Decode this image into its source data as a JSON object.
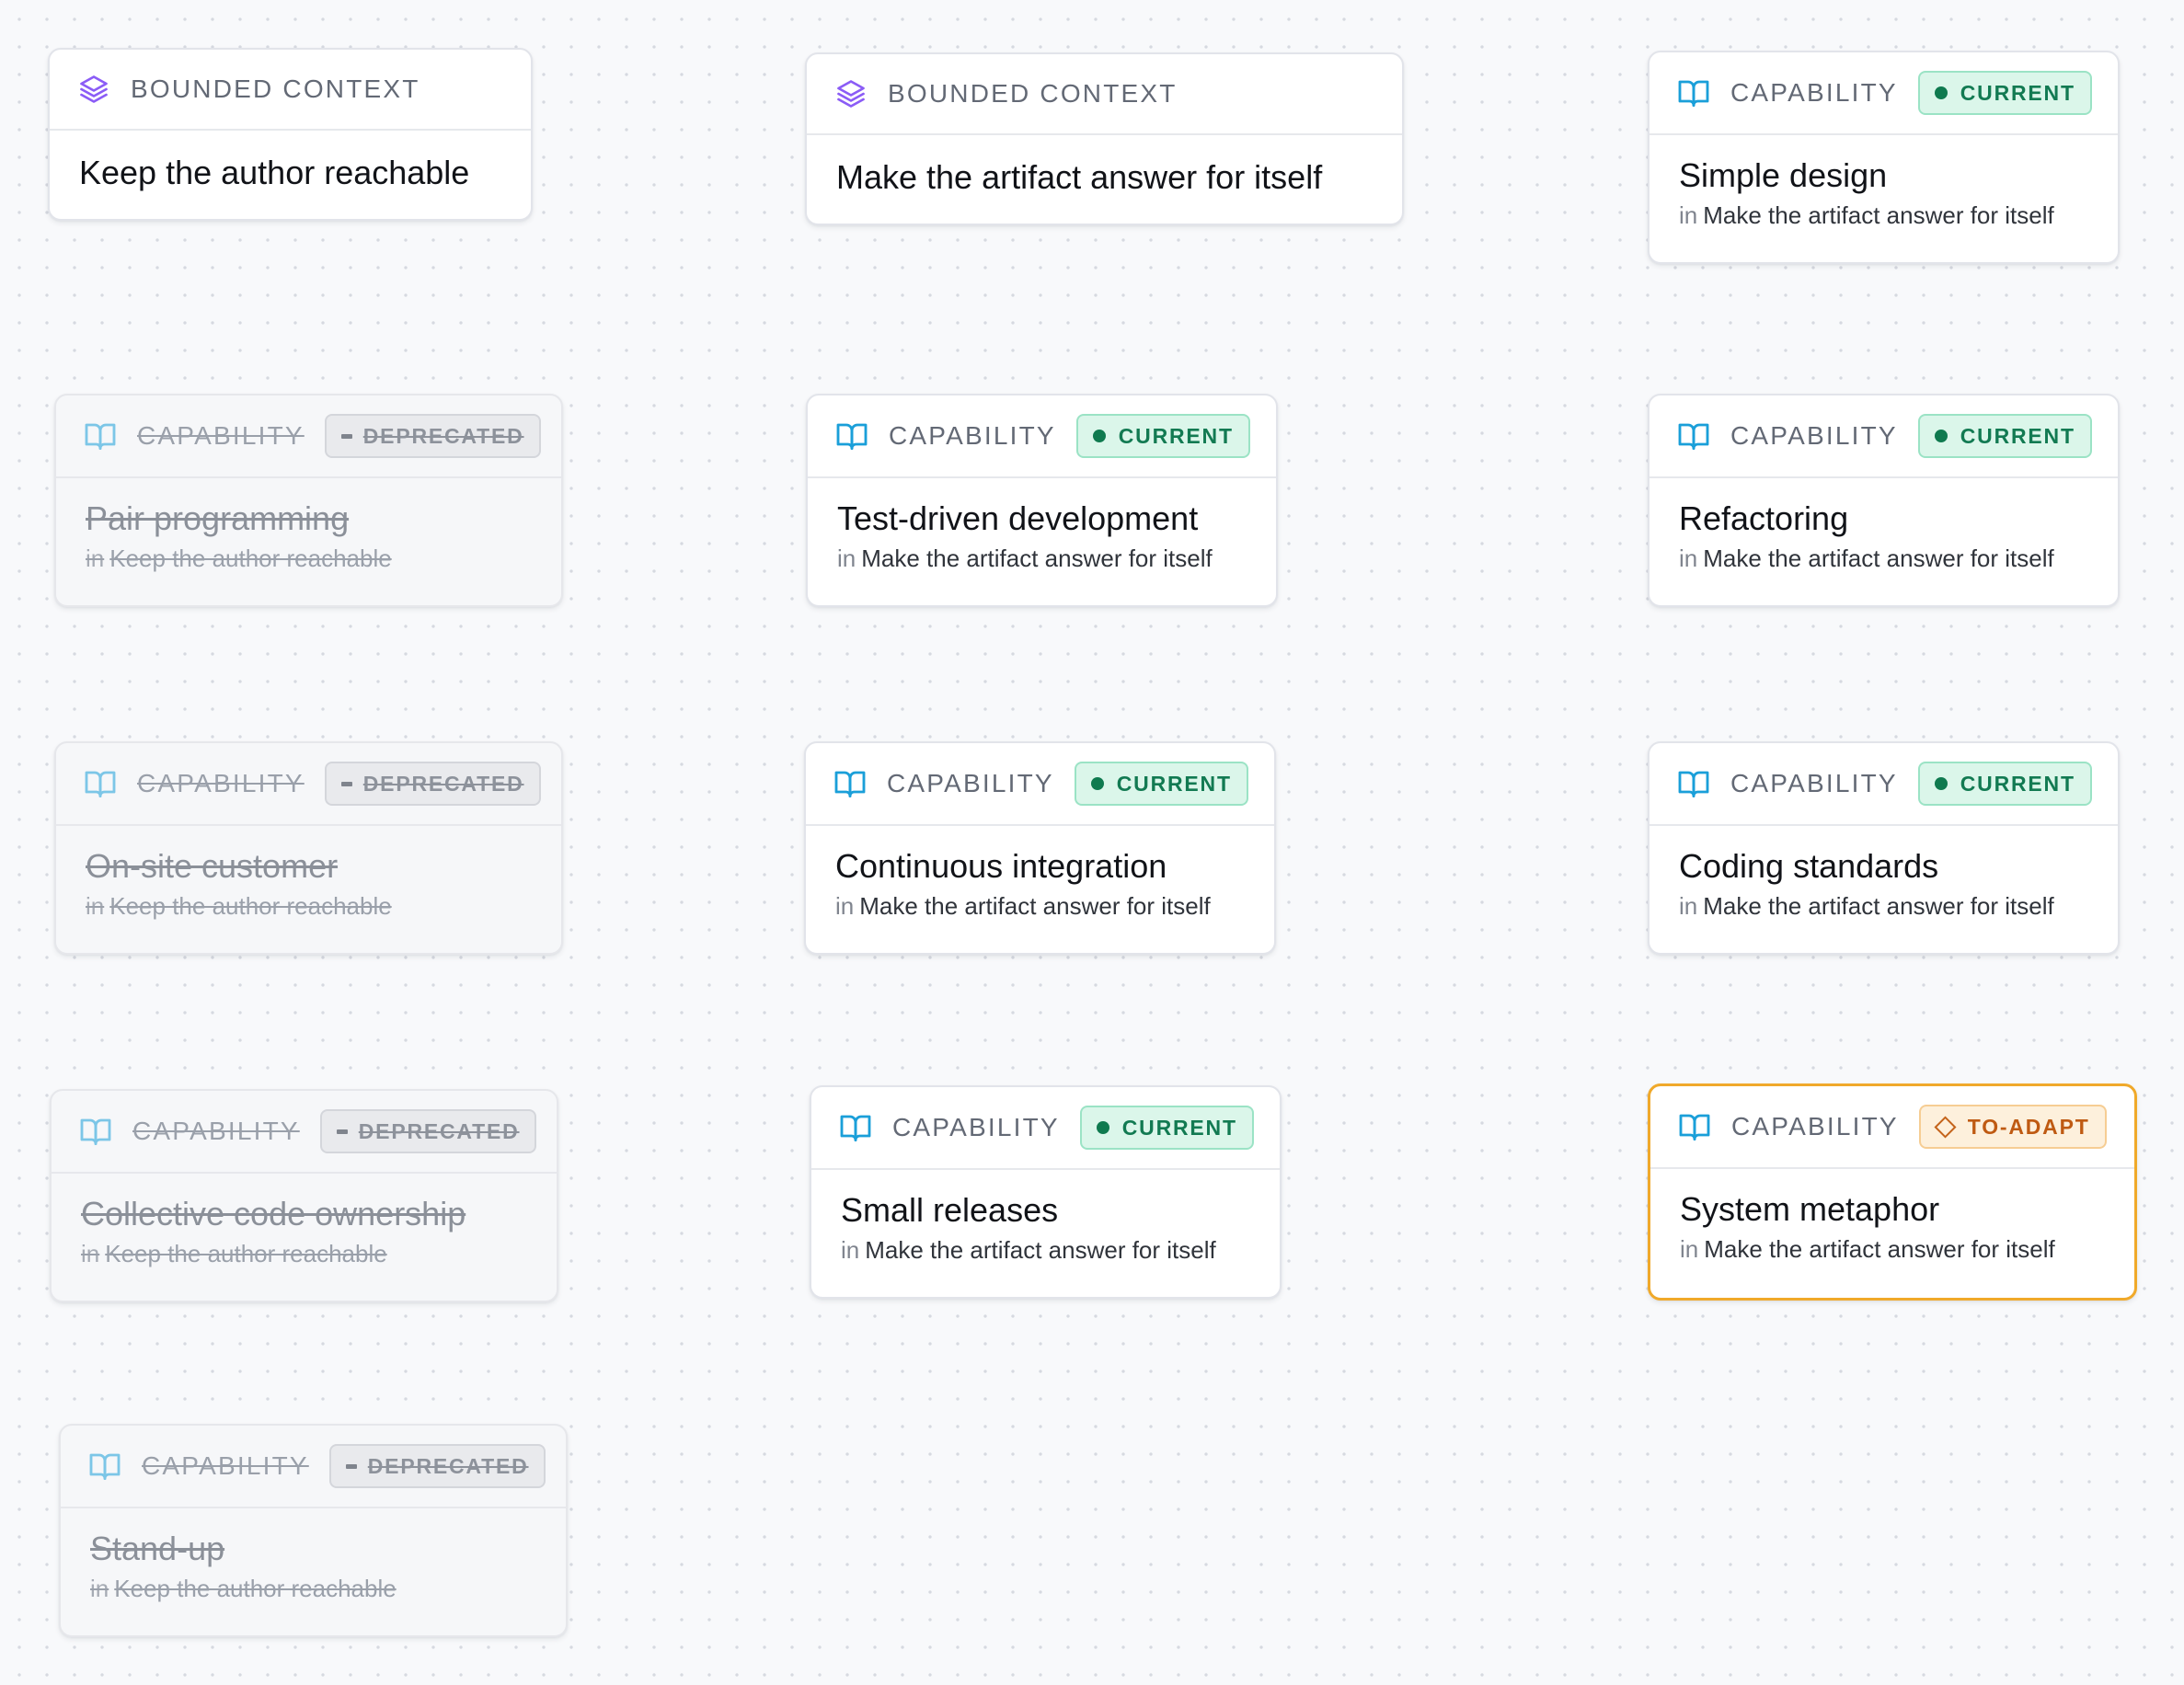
{
  "bounded_contexts": [
    {
      "kind": "BOUNDED CONTEXT",
      "title": "Keep the author reachable",
      "icon": "layers-icon"
    },
    {
      "kind": "BOUNDED CONTEXT",
      "title": "Make the artifact answer for itself",
      "icon": "layers-icon"
    }
  ],
  "capabilities": [
    {
      "kind": "CAPABILITY",
      "status": "CURRENT",
      "title": "Simple design",
      "context_prefix": "in",
      "context": "Make the artifact answer for itself",
      "icon": "book-open-icon"
    },
    {
      "kind": "CAPABILITY",
      "status": "DEPRECATED",
      "title": "Pair programming",
      "context_prefix": "in",
      "context": "Keep the author reachable",
      "icon": "book-open-icon"
    },
    {
      "kind": "CAPABILITY",
      "status": "CURRENT",
      "title": "Test-driven development",
      "context_prefix": "in",
      "context": "Make the artifact answer for itself",
      "icon": "book-open-icon"
    },
    {
      "kind": "CAPABILITY",
      "status": "CURRENT",
      "title": "Refactoring",
      "context_prefix": "in",
      "context": "Make the artifact answer for itself",
      "icon": "book-open-icon"
    },
    {
      "kind": "CAPABILITY",
      "status": "DEPRECATED",
      "title": "On-site customer",
      "context_prefix": "in",
      "context": "Keep the author reachable",
      "icon": "book-open-icon"
    },
    {
      "kind": "CAPABILITY",
      "status": "CURRENT",
      "title": "Continuous integration",
      "context_prefix": "in",
      "context": "Make the artifact answer for itself",
      "icon": "book-open-icon"
    },
    {
      "kind": "CAPABILITY",
      "status": "CURRENT",
      "title": "Coding standards",
      "context_prefix": "in",
      "context": "Make the artifact answer for itself",
      "icon": "book-open-icon"
    },
    {
      "kind": "CAPABILITY",
      "status": "DEPRECATED",
      "title": "Collective code ownership",
      "context_prefix": "in",
      "context": "Keep the author reachable",
      "icon": "book-open-icon"
    },
    {
      "kind": "CAPABILITY",
      "status": "CURRENT",
      "title": "Small releases",
      "context_prefix": "in",
      "context": "Make the artifact answer for itself",
      "icon": "book-open-icon"
    },
    {
      "kind": "CAPABILITY",
      "status": "TO-ADAPT",
      "title": "System metaphor",
      "context_prefix": "in",
      "context": "Make the artifact answer for itself",
      "icon": "book-open-icon"
    },
    {
      "kind": "CAPABILITY",
      "status": "DEPRECATED",
      "title": "Stand-up",
      "context_prefix": "in",
      "context": "Keep the author reachable",
      "icon": "book-open-icon"
    }
  ],
  "colors": {
    "canvas_background": "#f8f9fb",
    "layers_icon": "#8b5cf6",
    "book_icon": "#1a9fd9",
    "current": "#127a52",
    "deprecated": "#8d929b",
    "to_adapt": "#f0a92a"
  }
}
